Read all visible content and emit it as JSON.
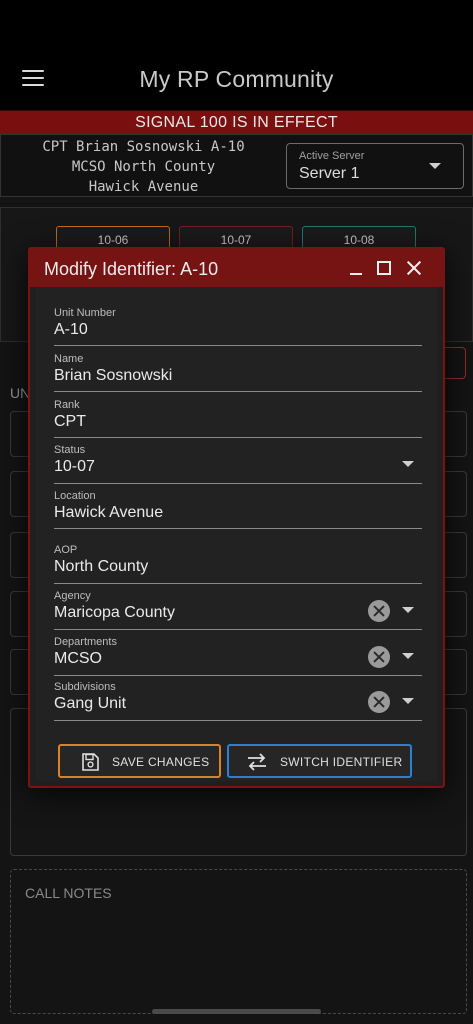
{
  "app": {
    "title": "My RP Community"
  },
  "signal": {
    "text": "SIGNAL 100 IS IN EFFECT"
  },
  "unit_info": {
    "line1": "CPT Brian Sosnowski A-10",
    "line2": "MCSO North County",
    "line3": "Hawick Avenue"
  },
  "server": {
    "label": "Active Server",
    "value": "Server 1"
  },
  "status_buttons": [
    "10-06",
    "10-07",
    "10-08"
  ],
  "background": {
    "partial_label": "UN",
    "call_notes_label": "CALL NOTES"
  },
  "modal": {
    "title": "Modify Identifier: A-10",
    "fields": {
      "unit_number": {
        "label": "Unit Number",
        "value": "A-10"
      },
      "name": {
        "label": "Name",
        "value": "Brian Sosnowski"
      },
      "rank": {
        "label": "Rank",
        "value": "CPT"
      },
      "status": {
        "label": "Status",
        "value": "10-07"
      },
      "location": {
        "label": "Location",
        "value": "Hawick Avenue"
      },
      "aop": {
        "label": "AOP",
        "value": "North County"
      },
      "agency": {
        "label": "Agency",
        "value": "Maricopa County"
      },
      "departments": {
        "label": "Departments",
        "value": "MCSO"
      },
      "subdivisions": {
        "label": "Subdivisions",
        "value": "Gang Unit"
      }
    },
    "save_label": "SAVE CHANGES",
    "switch_label": "SWITCH IDENTIFIER"
  },
  "colors": {
    "accent_red": "#761313",
    "save_border": "#d9822b",
    "switch_border": "#2d7fd1",
    "status_10_06": "#c56a1c",
    "status_10_07": "#7b1c1c",
    "status_10_08": "#1e7a7a"
  }
}
